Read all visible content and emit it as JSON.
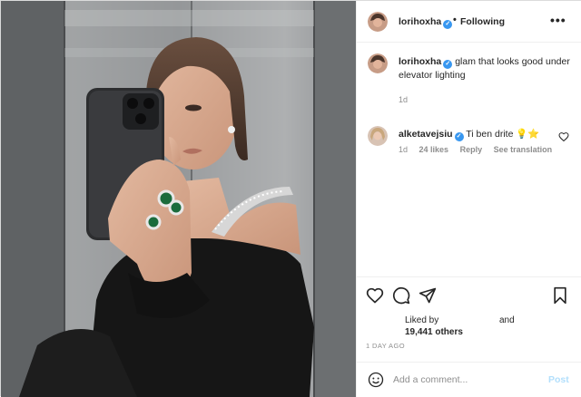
{
  "post": {
    "author": "lorihoxha",
    "separator": "•",
    "follow_label": "Following",
    "more_label": "•••",
    "caption_text": "glam that looks good under elevator lighting",
    "caption_time": "1d",
    "verified_mark": "✓"
  },
  "comment": {
    "author": "alketavejsiu",
    "text": "Ti ben drite 💡⭐",
    "time": "1d",
    "likes": "24 likes",
    "reply_label": "Reply",
    "translation_label": "See translation"
  },
  "engagement": {
    "liked_by_prefix": "Liked by",
    "like_count": "19,441 others",
    "and_label": "and",
    "time_ago": "1 DAY AGO"
  },
  "add_comment": {
    "placeholder": "Add a comment...",
    "post_label": "Post"
  },
  "icons": {
    "like": "heart-icon",
    "comment": "comment-icon",
    "share": "paper-plane-icon",
    "save": "bookmark-icon",
    "emoji": "smiley-icon"
  },
  "colors": {
    "verified": "#3897f0",
    "post_disabled": "#b2dffc",
    "muted_text": "#8e8e8e"
  }
}
